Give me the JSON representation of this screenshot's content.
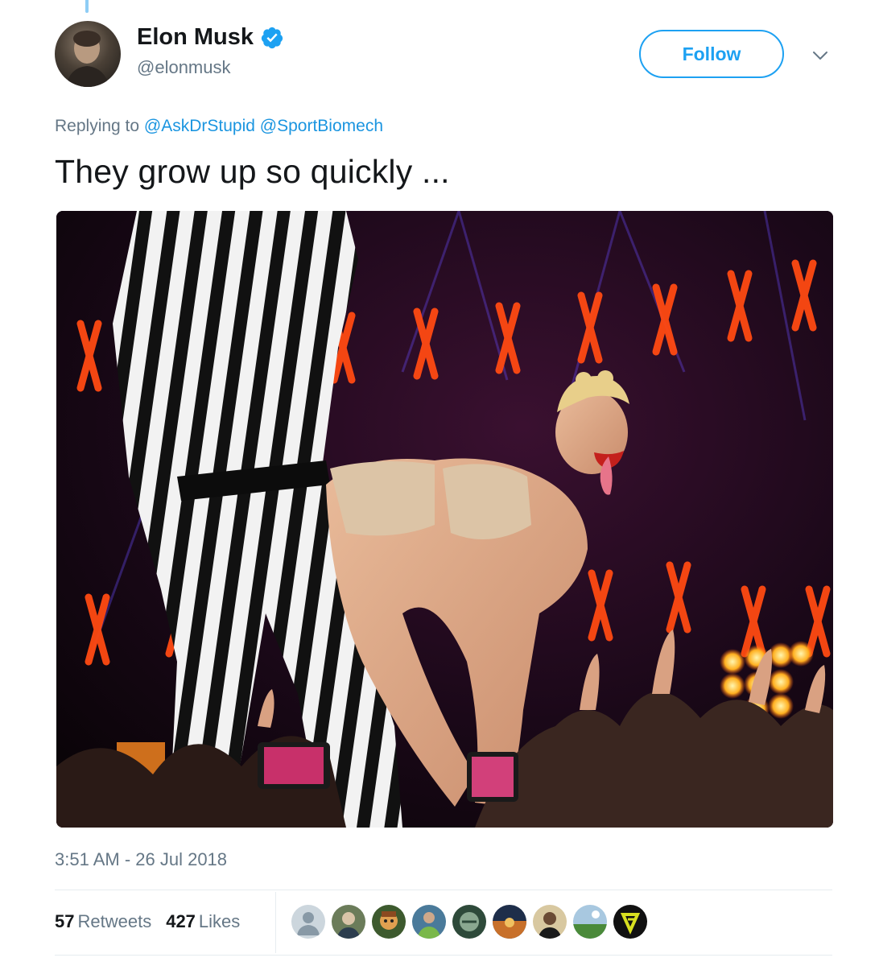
{
  "author": {
    "display_name": "Elon Musk",
    "handle": "@elonmusk",
    "verified": true
  },
  "follow_label": "Follow",
  "reply_context": {
    "prefix": "Replying to",
    "mentions": [
      "@AskDrStupid",
      "@SportBiomech"
    ]
  },
  "tweet_text": "They grow up so quickly ...",
  "timestamp": "3:51 AM - 26 Jul 2018",
  "stats": {
    "retweets_count": "57",
    "retweets_label": "Retweets",
    "likes_count": "427",
    "likes_label": "Likes"
  },
  "liker_avatars": [
    "default-avatar",
    "avatar-2",
    "avatar-3",
    "avatar-4",
    "avatar-5",
    "avatar-6",
    "avatar-7",
    "avatar-8",
    "avatar-9"
  ],
  "colors": {
    "accent": "#1da1f2",
    "link": "#1b95e0",
    "secondary_text": "#657786",
    "primary_text": "#14171a",
    "stage_glow": "#ff4a12"
  }
}
